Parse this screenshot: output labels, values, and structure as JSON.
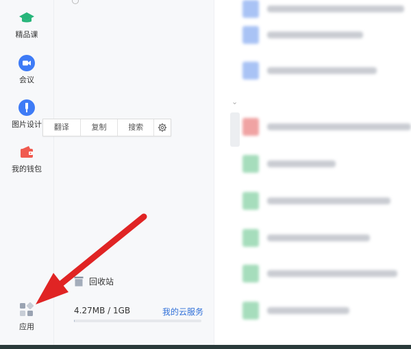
{
  "nav": {
    "items": [
      {
        "label": "精品课",
        "icon": "graduation-cap-icon",
        "color": "#27b57a"
      },
      {
        "label": "会议",
        "icon": "video-camera-icon",
        "color": "#3e7bf6"
      },
      {
        "label": "图片设计",
        "icon": "brush-icon",
        "color": "#3e7bf6"
      },
      {
        "label": "我的钱包",
        "icon": "wallet-icon",
        "color": "#f05a4f"
      }
    ],
    "apps": {
      "label": "应用",
      "icon": "apps-grid-icon"
    }
  },
  "context_toolbar": {
    "translate": "翻译",
    "copy": "复制",
    "search": "搜索",
    "settings_icon": "gear-icon"
  },
  "recycle_bin": {
    "label": "回收站",
    "icon": "trash-icon"
  },
  "storage": {
    "used_text": "4.27MB / 1GB",
    "cloud_link": "我的云服务",
    "used_fraction": 0.004
  },
  "colors": {
    "accent_blue": "#2f6fd8",
    "annotation_red": "#e02424"
  }
}
